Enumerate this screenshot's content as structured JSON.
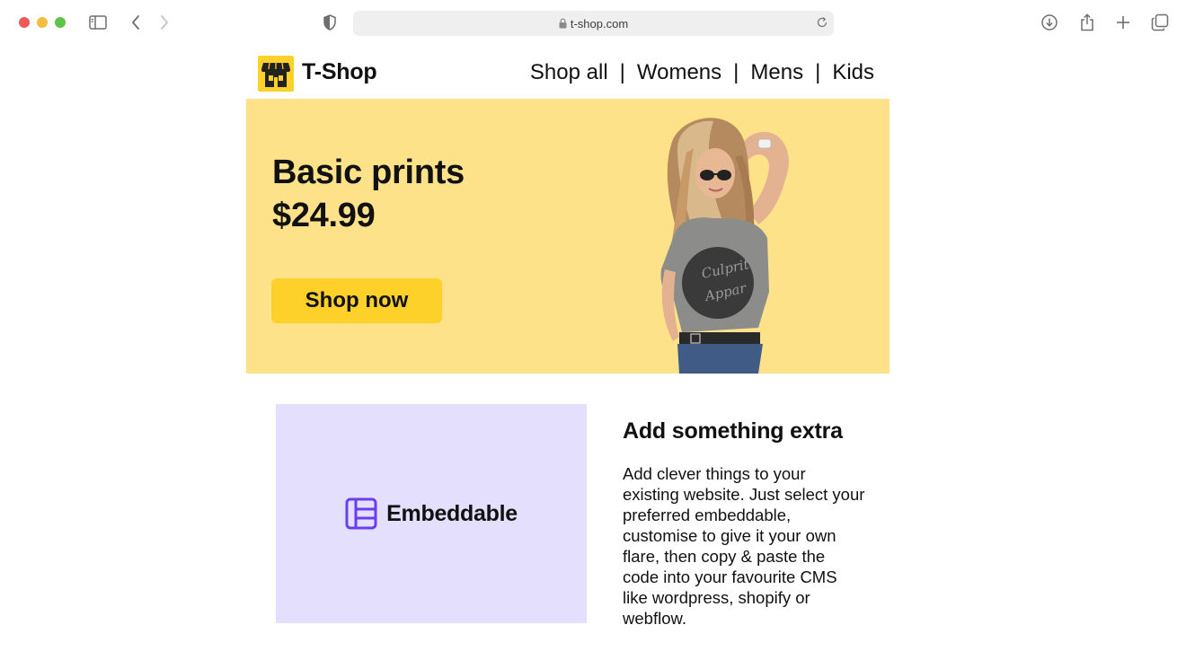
{
  "browser": {
    "url": "t-shop.com"
  },
  "site": {
    "brand": "T-Shop",
    "nav": [
      {
        "label": "Shop all"
      },
      {
        "label": "Womens"
      },
      {
        "label": "Mens"
      },
      {
        "label": "Kids"
      }
    ],
    "nav_separator": "|"
  },
  "hero": {
    "title_line1": "Basic prints",
    "title_line2": "$24.99",
    "cta_label": "Shop now",
    "shirt_print_line1": "Culprit",
    "shirt_print_line2": "Appar"
  },
  "feature": {
    "embed_brand": "Embeddable",
    "title": "Add something extra",
    "body": "Add clever things to your existing website. Just select your preferred embeddable, customise to give it your own flare, then copy & paste the code into your favourite CMS like wordpress, shopify or webflow."
  },
  "colors": {
    "brand_yellow": "#fdd12a",
    "hero_bg": "#fde289",
    "embed_bg": "#e4dffd",
    "embed_accent": "#6a3df0"
  }
}
